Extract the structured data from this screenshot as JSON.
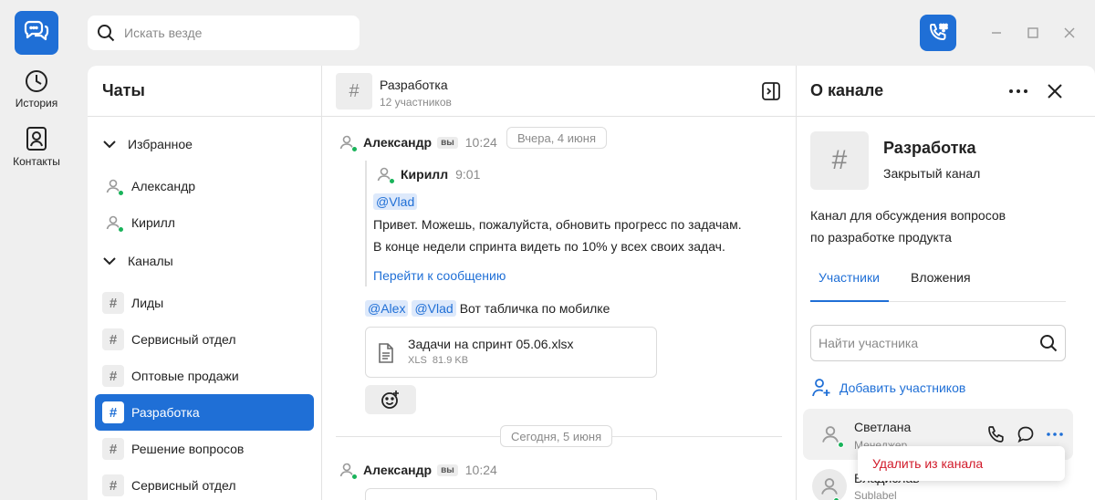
{
  "rail": {
    "history_label": "История",
    "contacts_label": "Контакты"
  },
  "topbar": {
    "search_placeholder": "Искать везде"
  },
  "chats": {
    "title": "Чаты",
    "groups": [
      {
        "label": "Избранное",
        "items": [
          "Александр",
          "Кирилл"
        ]
      },
      {
        "label": "Каналы",
        "items": [
          "Лиды",
          "Сервисный отдел",
          "Оптовые продажи",
          "Разработка",
          "Решение вопросов",
          "Сервисный отдел"
        ]
      }
    ],
    "active_item": "Разработка"
  },
  "channel": {
    "name": "Разработка",
    "participants": "12 участников"
  },
  "messages": {
    "date1": "Вчера, 4 июня",
    "date2": "Сегодня, 5 июня",
    "m1": {
      "author": "Александр",
      "badge": "вы",
      "time": "10:24",
      "quote": {
        "author": "Кирилл",
        "time": "9:01",
        "mention": "@Vlad",
        "line1": "Привет. Можешь, пожалуйста, обновить прогресс по задачам.",
        "line2": "В конце недели спринта видеть по 10% у всех своих задач.",
        "goto": "Перейти к сообщению"
      },
      "mention1": "@Alex",
      "mention2": "@Vlad",
      "text": "Вот табличка по мобилке",
      "file": {
        "name": "Задачи на спринт 05.06.xlsx",
        "ext": "XLS",
        "size": "81.9 KB"
      }
    },
    "m2": {
      "author": "Александр",
      "badge": "вы",
      "time": "10:24"
    }
  },
  "info": {
    "title": "О канале",
    "channel_name": "Разработка",
    "channel_type": "Закрытый канал",
    "desc_line1": "Канал для обсуждения вопросов",
    "desc_line2": "по разработке продукта",
    "tab_members": "Участники",
    "tab_attachments": "Вложения",
    "member_search_placeholder": "Найти участника",
    "add_members": "Добавить участников",
    "members": [
      {
        "name": "Светлана",
        "role": "Менеджер"
      },
      {
        "name": "Владислав",
        "role": "Sublabel"
      }
    ],
    "menu_remove": "Удалить из канала"
  },
  "colors": {
    "accent": "#1f6fd6",
    "online": "#19b35a",
    "danger": "#d11a2a"
  }
}
